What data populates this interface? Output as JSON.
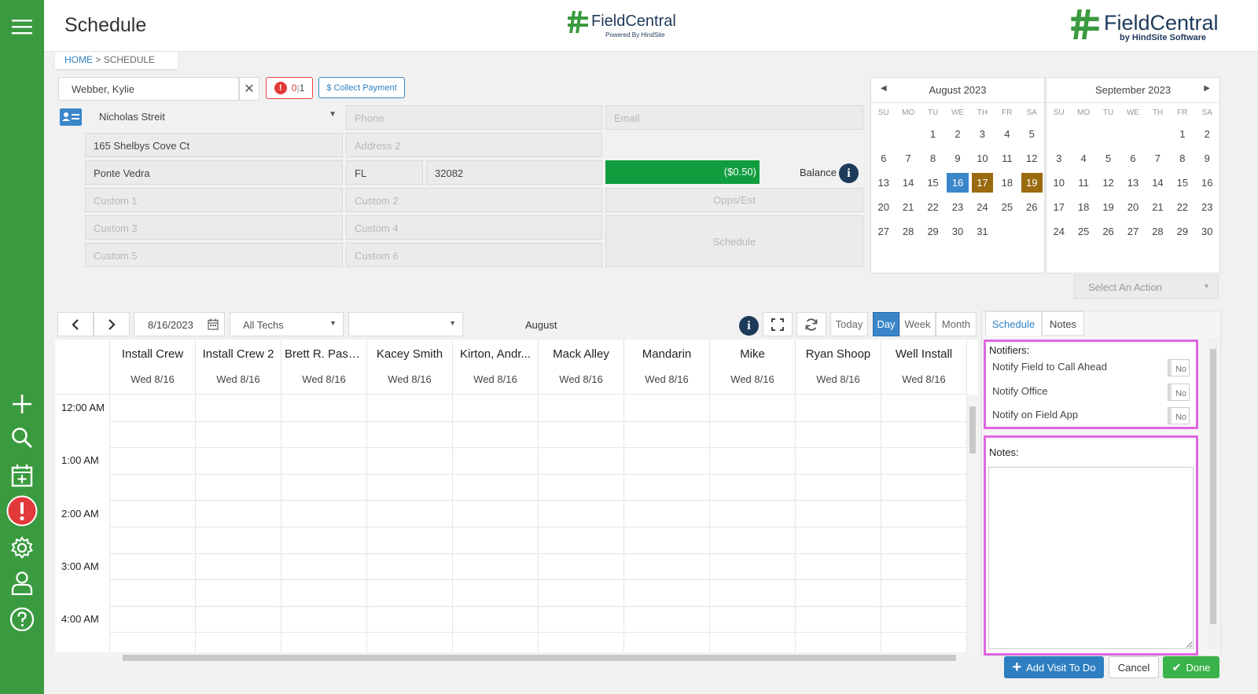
{
  "app": {
    "title": "Schedule",
    "logo_center": "FieldCentral",
    "logo_center_sub": "Powered By HindSite",
    "logo_right": "FieldCentral",
    "logo_right_sub": "by HindSite Software"
  },
  "breadcrumb": {
    "home": "HOME",
    "sep": " > ",
    "current": "SCHEDULE"
  },
  "customer": {
    "name": "Webber, Kylie",
    "alert_count": "0",
    "alert_total": "1",
    "collect_payment": "$ Collect Payment",
    "contact": "Nicholas Streit",
    "phone_placeholder": "Phone",
    "email_placeholder": "Email",
    "address1": "165 Shelbys Cove Ct",
    "address2_placeholder": "Address 2",
    "city": "Ponte Vedra",
    "state": "FL",
    "zip": "32082",
    "balance_value": "($0.50)",
    "balance_label": "Balance",
    "custom": [
      "Custom 1",
      "Custom 2",
      "Custom 3",
      "Custom 4",
      "Custom 5",
      "Custom 6"
    ],
    "opps_label": "Opps/Est",
    "schedule_label": "Schedule"
  },
  "calendars": [
    {
      "title": "August 2023",
      "dow": [
        "SU",
        "MO",
        "TU",
        "WE",
        "TH",
        "FR",
        "SA"
      ],
      "offset": 2,
      "days": 31,
      "selected": [
        16
      ],
      "marked": [
        17,
        19
      ]
    },
    {
      "title": "September 2023",
      "dow": [
        "SU",
        "MO",
        "TU",
        "WE",
        "TH",
        "FR",
        "SA"
      ],
      "offset": 5,
      "days": 30,
      "selected": [],
      "marked": []
    }
  ],
  "select_action": "Select An Action",
  "toolbar": {
    "date": "8/16/2023",
    "techs": "All Techs",
    "month_label": "August",
    "today": "Today",
    "day": "Day",
    "week": "Week",
    "month": "Month"
  },
  "columns": [
    {
      "name": "Install Crew",
      "date": "Wed 8/16"
    },
    {
      "name": "Install Crew 2",
      "date": "Wed 8/16"
    },
    {
      "name": "Brett R. Passi...",
      "date": "Wed 8/16"
    },
    {
      "name": "Kacey Smith",
      "date": "Wed 8/16"
    },
    {
      "name": "Kirton, Andr...",
      "date": "Wed 8/16"
    },
    {
      "name": "Mack Alley",
      "date": "Wed 8/16"
    },
    {
      "name": "Mandarin",
      "date": "Wed 8/16"
    },
    {
      "name": "Mike",
      "date": "Wed 8/16"
    },
    {
      "name": "Ryan Shoop",
      "date": "Wed 8/16"
    },
    {
      "name": "Well Install",
      "date": "Wed 8/16"
    }
  ],
  "times": [
    "12:00 AM",
    "1:00 AM",
    "2:00 AM",
    "3:00 AM",
    "4:00 AM"
  ],
  "right_panel": {
    "tabs": [
      "Schedule",
      "Notes"
    ],
    "notifiers_title": "Notifiers:",
    "notifiers": [
      {
        "label": "Notify Field to Call Ahead",
        "value": "No"
      },
      {
        "label": "Notify Office",
        "value": "No"
      },
      {
        "label": "Notify on Field App",
        "value": "No"
      }
    ],
    "notes_title": "Notes:"
  },
  "actions": {
    "add_visit": "Add Visit To Do",
    "cancel": "Cancel",
    "done": "Done"
  },
  "colors": {
    "sidebar": "#3a9a3f",
    "balance": "#0f9d3e",
    "selected_day": "#3a86c9",
    "marked_day": "#9a6a0f",
    "highlight": "#e066e0",
    "primary": "#2e7fc1"
  }
}
